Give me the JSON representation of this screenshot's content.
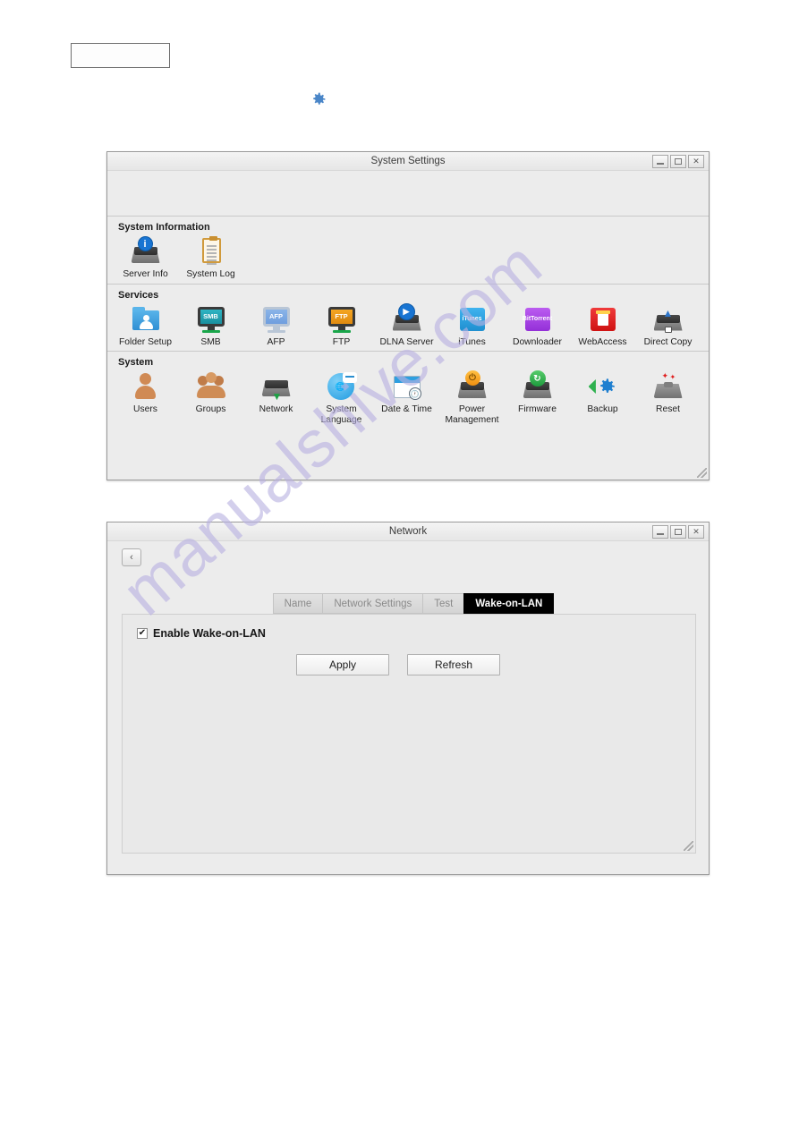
{
  "document": {
    "top_badge_text": "",
    "gear_icon": "gear-icon",
    "watermark": "manualshive.com"
  },
  "system_settings_window": {
    "title": "System Settings",
    "controls": {
      "minimize": "_",
      "maximize": "□",
      "close": "×"
    },
    "sections": [
      {
        "title": "System Information",
        "items": [
          {
            "label": "Server Info",
            "icon": "server-info-icon"
          },
          {
            "label": "System Log",
            "icon": "system-log-icon"
          }
        ]
      },
      {
        "title": "Services",
        "items": [
          {
            "label": "Folder Setup",
            "icon": "folder-setup-icon"
          },
          {
            "label": "SMB",
            "icon": "smb-icon",
            "badge": "SMB"
          },
          {
            "label": "AFP",
            "icon": "afp-icon",
            "badge": "AFP"
          },
          {
            "label": "FTP",
            "icon": "ftp-icon",
            "badge": "FTP"
          },
          {
            "label": "DLNA Server",
            "icon": "dlna-server-icon"
          },
          {
            "label": "iTunes",
            "icon": "itunes-icon",
            "badge": "iTunes"
          },
          {
            "label": "Downloader",
            "icon": "downloader-icon",
            "badge": "BitTorrent"
          },
          {
            "label": "WebAccess",
            "icon": "webaccess-icon"
          },
          {
            "label": "Direct Copy",
            "icon": "direct-copy-icon"
          }
        ]
      },
      {
        "title": "System",
        "items": [
          {
            "label": "Users",
            "icon": "users-icon"
          },
          {
            "label": "Groups",
            "icon": "groups-icon"
          },
          {
            "label": "Network",
            "icon": "network-icon"
          },
          {
            "label": "System Language",
            "icon": "system-language-icon"
          },
          {
            "label": "Date & Time",
            "icon": "date-time-icon"
          },
          {
            "label": "Power Management",
            "icon": "power-management-icon"
          },
          {
            "label": "Firmware",
            "icon": "firmware-icon"
          },
          {
            "label": "Backup",
            "icon": "backup-icon"
          },
          {
            "label": "Reset",
            "icon": "reset-icon"
          }
        ]
      }
    ]
  },
  "network_window": {
    "title": "Network",
    "controls": {
      "minimize": "_",
      "maximize": "□",
      "close": "×"
    },
    "back_button": "‹",
    "tabs": [
      {
        "label": "Name",
        "active": false
      },
      {
        "label": "Network Settings",
        "active": false
      },
      {
        "label": "Test",
        "active": false
      },
      {
        "label": "Wake-on-LAN",
        "active": true
      }
    ],
    "checkbox": {
      "label": "Enable Wake-on-LAN",
      "checked": true
    },
    "buttons": {
      "apply": "Apply",
      "refresh": "Refresh"
    }
  },
  "colors": {
    "accent_blue": "#3d7fc1",
    "tab_active_bg": "#000000",
    "window_bg": "#ececec",
    "watermark": "#b9b2e2"
  }
}
